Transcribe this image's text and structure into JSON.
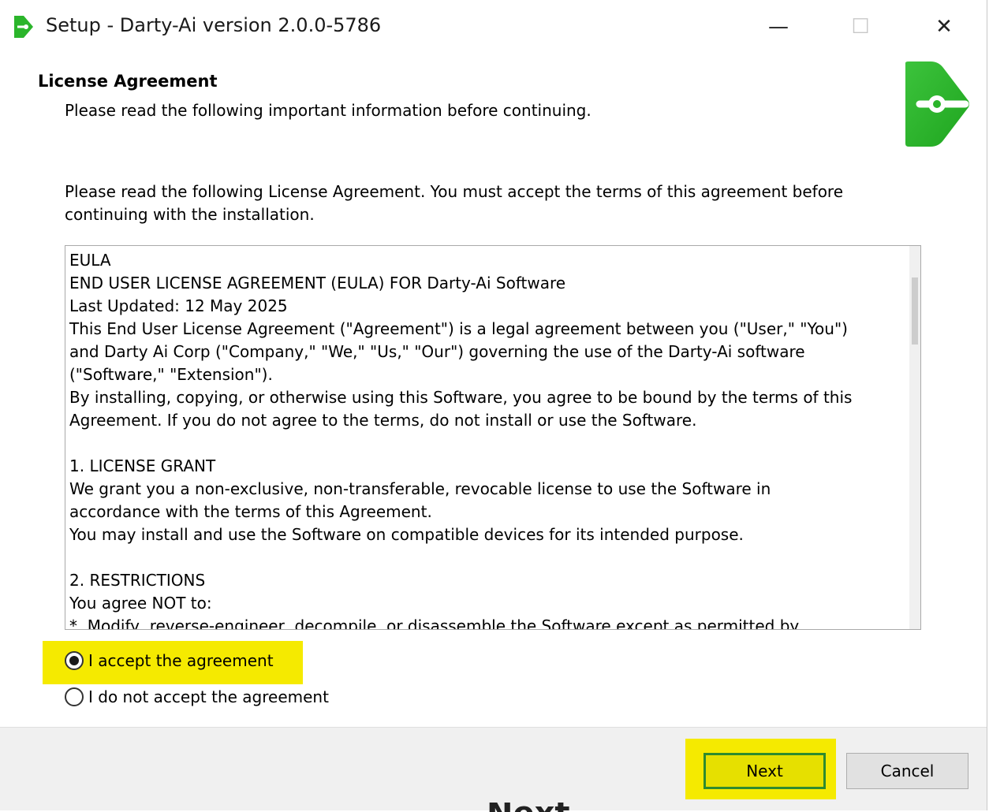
{
  "window": {
    "title": "Setup - Darty-Ai version 2.0.0-5786",
    "icons": {
      "app": "darty-ai-app-icon",
      "minimize": "minimize-icon",
      "maximize": "maximize-icon",
      "close": "close-icon"
    },
    "glyphs": {
      "minimize": "—",
      "maximize": "☐",
      "close": "✕"
    }
  },
  "header": {
    "title": "License Agreement",
    "subtitle": "Please read the following important information before continuing.",
    "logo": "darty-ai-logo"
  },
  "intro": "Please read the following License Agreement. You must accept the terms of this agreement before continuing with the installation.",
  "eula": {
    "lines": [
      "EULA",
      "END USER LICENSE AGREEMENT (EULA) FOR Darty-Ai Software",
      "Last Updated: 12 May 2025",
      "This End User License Agreement (\"Agreement\") is a legal agreement between you (\"User,\" \"You\")",
      "and Darty Ai Corp (\"Company,\" \"We,\" \"Us,\" \"Our\") governing the use of the Darty-Ai software",
      "(\"Software,\" \"Extension\").",
      "By installing, copying, or otherwise using this Software, you agree to be bound by the terms of this",
      "Agreement. If you do not agree to the terms, do not install or use the Software.",
      "",
      "1. LICENSE GRANT",
      "We grant you a non-exclusive, non-transferable, revocable license to use the Software in",
      "accordance with the terms of this Agreement.",
      "You may install and use the Software on compatible devices for its intended purpose.",
      "",
      "2. RESTRICTIONS",
      "You agree NOT to:",
      "*  Modify, reverse-engineer, decompile, or disassemble the Software except as permitted by"
    ]
  },
  "options": {
    "accept_label": "I accept the agreement",
    "decline_label": "I do not accept the agreement",
    "selected": "accept"
  },
  "buttons": {
    "next_label": "Next",
    "cancel_label": "Cancel"
  },
  "colors": {
    "brand_green": "#2bb52b",
    "highlight": "#f5ea00",
    "footer_bg": "#f0f0f0"
  },
  "background_text": "Next"
}
